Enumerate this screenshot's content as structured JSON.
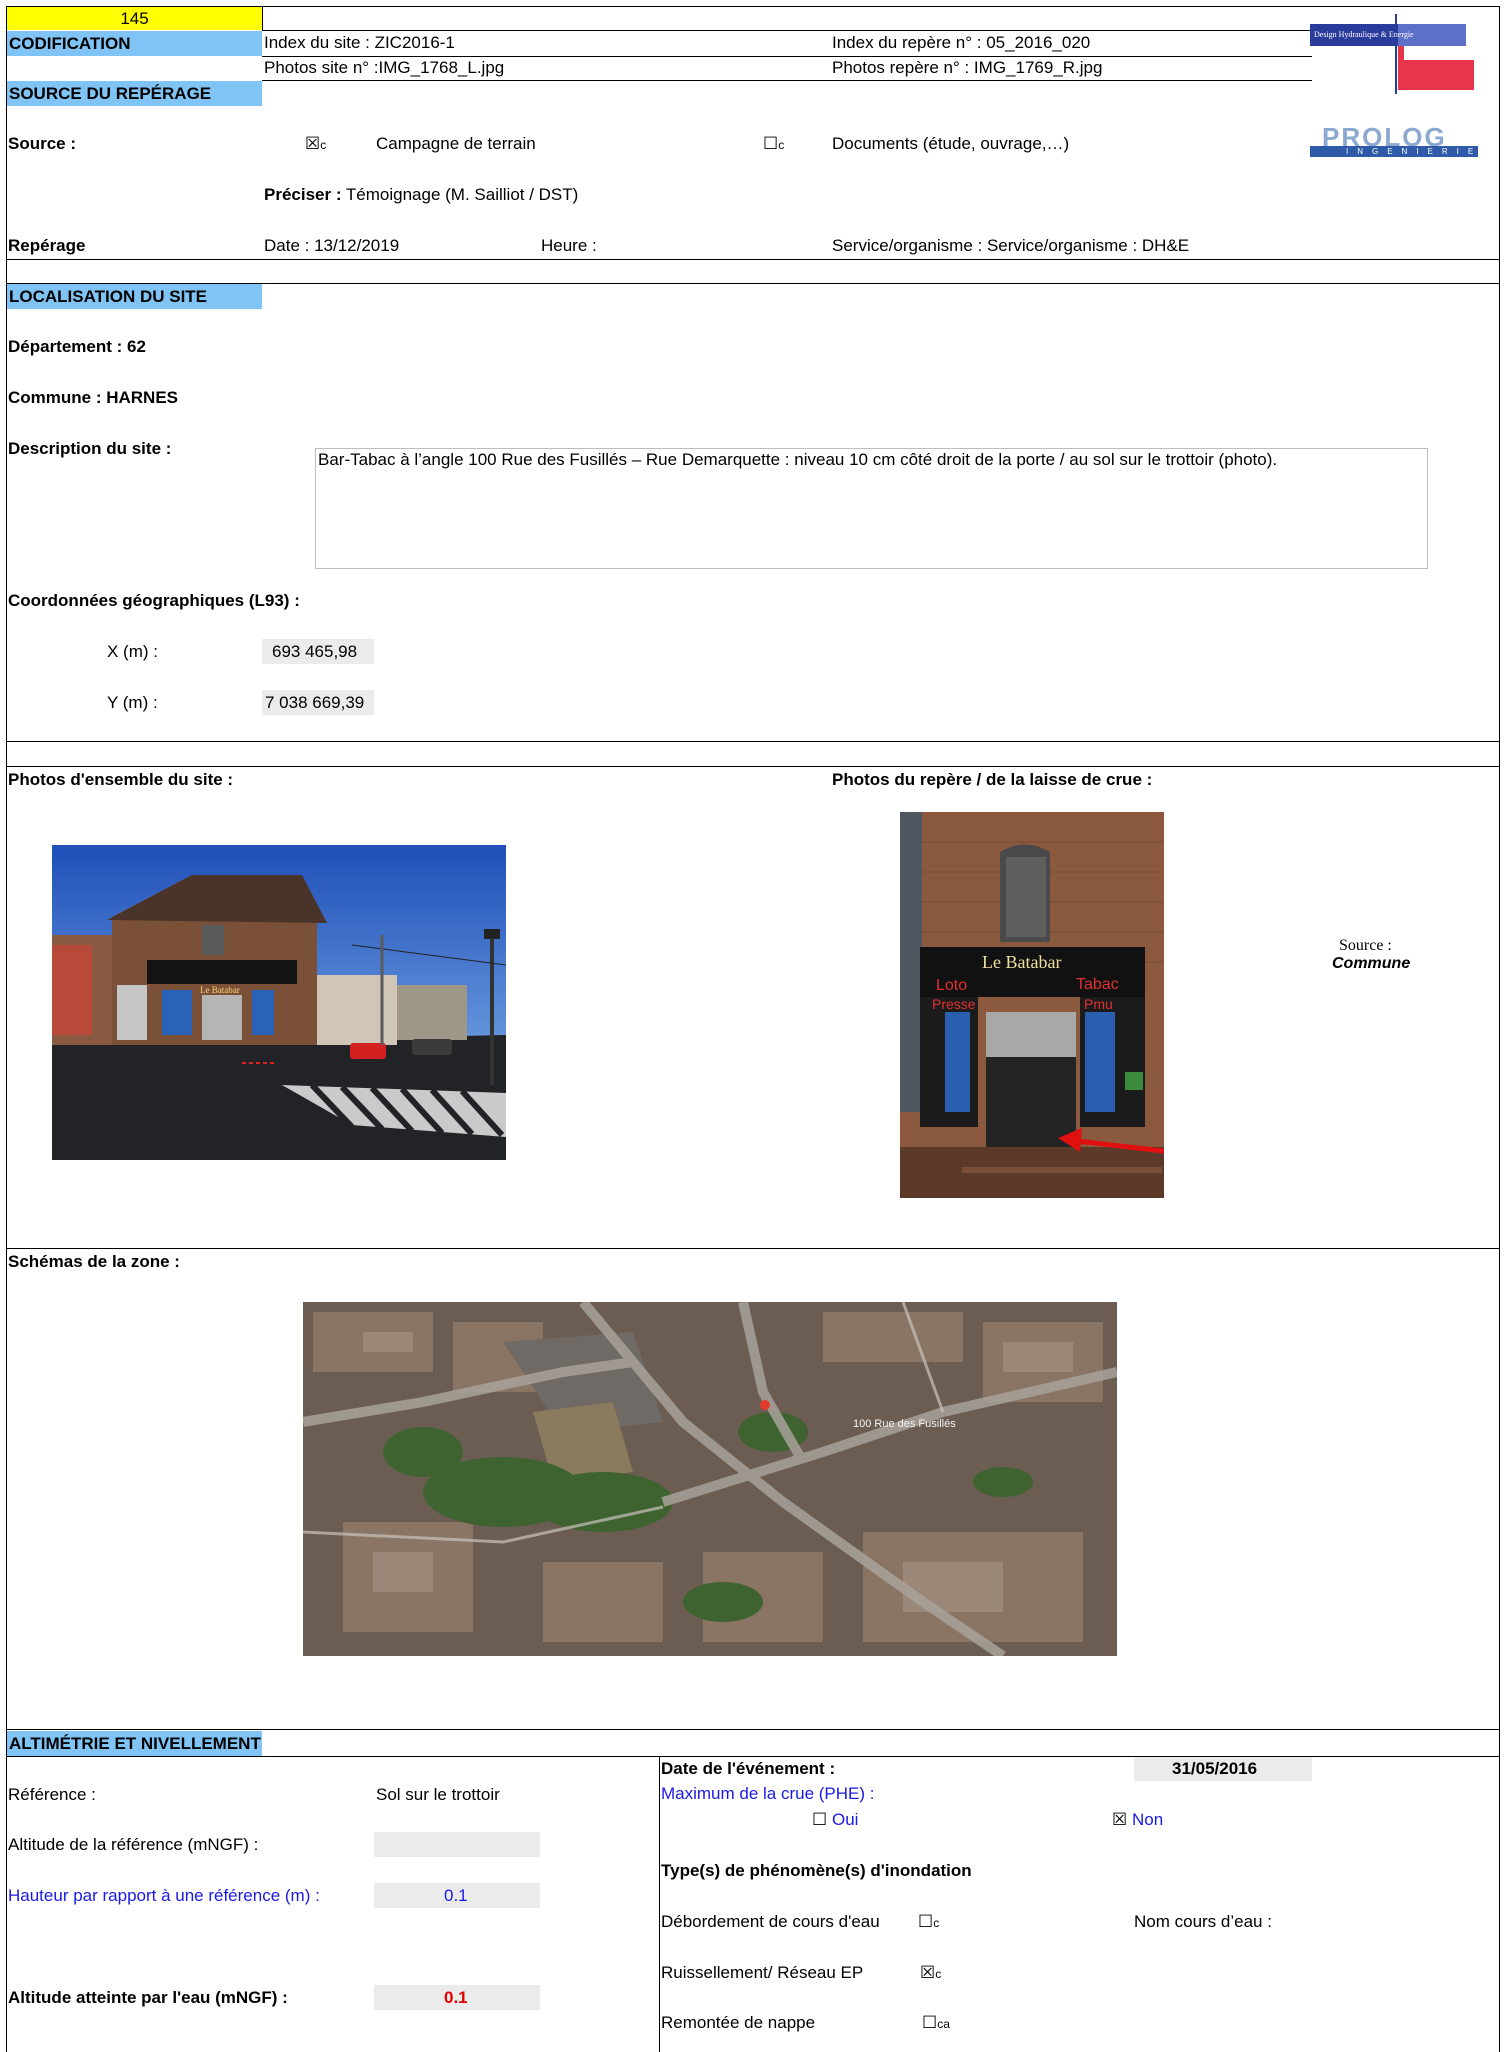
{
  "id_number": "145",
  "codification": {
    "label": "CODIFICATION",
    "site_index": "Index du site :  ZIC2016-1",
    "site_photos": "Photos site n° :IMG_1768_L.jpg",
    "marker_index": "Index du repère n° : 05_2016_020",
    "marker_photos": "Photos repère n° : IMG_1769_R.jpg"
  },
  "logos": {
    "dhe_text": "Design Hydraulique & Energie",
    "prolog_text": "PROLOG",
    "prolog_sub": "INGENIERIE"
  },
  "source": {
    "section_title": "SOURCE DU REPÉRAGE",
    "label": "Source :",
    "option1_check": "☒",
    "option1_tail": "c",
    "option1_label": "Campagne de terrain",
    "option2_check": "☐",
    "option2_tail": "c",
    "option2_label": "Documents (étude, ouvrage,…)",
    "preciser_label": "Préciser :",
    "preciser_value": " Témoignage  (M. Sailliot / DST)",
    "reperage_label": "Repérage",
    "date": "Date : 13/12/2019",
    "heure": "Heure :",
    "service": "Service/organisme : Service/organisme : DH&E"
  },
  "localisation": {
    "section_title": "LOCALISATION DU SITE",
    "departement": "Département :  62",
    "commune": "Commune : HARNES",
    "description_label": "Description du site :",
    "description": "Bar-Tabac à l’angle 100 Rue des Fusillés – Rue Demarquette : niveau 10 cm côté droit de la porte / au sol sur le trottoir (photo).",
    "coords_label": "Coordonnées géographiques (L93) :",
    "x_label": "X (m) :",
    "x_value": "693 465,98",
    "y_label": "Y (m) :",
    "y_value": "7 038 669,39"
  },
  "photos": {
    "site_label": "Photos d'ensemble du site :",
    "marker_label": "Photos du repère / de la laisse de crue  :",
    "source_label": "Source :",
    "source_value": "Commune",
    "shop_sign": "Le Batabar",
    "shop_left": "Loto",
    "shop_left2": "Presse",
    "shop_right": "Tabac",
    "shop_right2": "Pmu"
  },
  "schema": {
    "label": "Schémas de la zone :",
    "map_label": "100 Rue des Fusillés"
  },
  "altimetrie": {
    "section_title": "ALTIMÉTRIE ET NIVELLEMENT",
    "reference_label": "Référence :",
    "reference_value": "Sol sur le trottoir",
    "alt_ref_label": "Altitude de la référence (mNGF)  :",
    "alt_ref_value": "",
    "hauteur_label": "Hauteur par rapport à une référence (m) :",
    "hauteur_value": "0.1",
    "alt_atteinte_label": "Altitude atteinte par l'eau (mNGF) :",
    "alt_atteinte_value": "0.1",
    "date_label": "Date de l'événement :",
    "date_value": "31/05/2016",
    "phe_label": "Maximum de la crue (PHE) :",
    "oui_check": "☐",
    "oui_label": "Oui",
    "non_check": "☒",
    "non_label": "Non",
    "types_label": "Type(s) de phénomène(s) d'inondation",
    "debordement_label": "Débordement de cours d'eau",
    "debordement_check": "☐",
    "debordement_tail": "c",
    "nom_cours_label": "Nom cours d’eau :",
    "ruissellement_label": "Ruissellement/ Réseau EP",
    "ruissellement_check": "☒",
    "ruissellement_tail": "c",
    "nappe_label": "Remontée de nappe",
    "nappe_check": "☐",
    "nappe_tail": "ca"
  }
}
